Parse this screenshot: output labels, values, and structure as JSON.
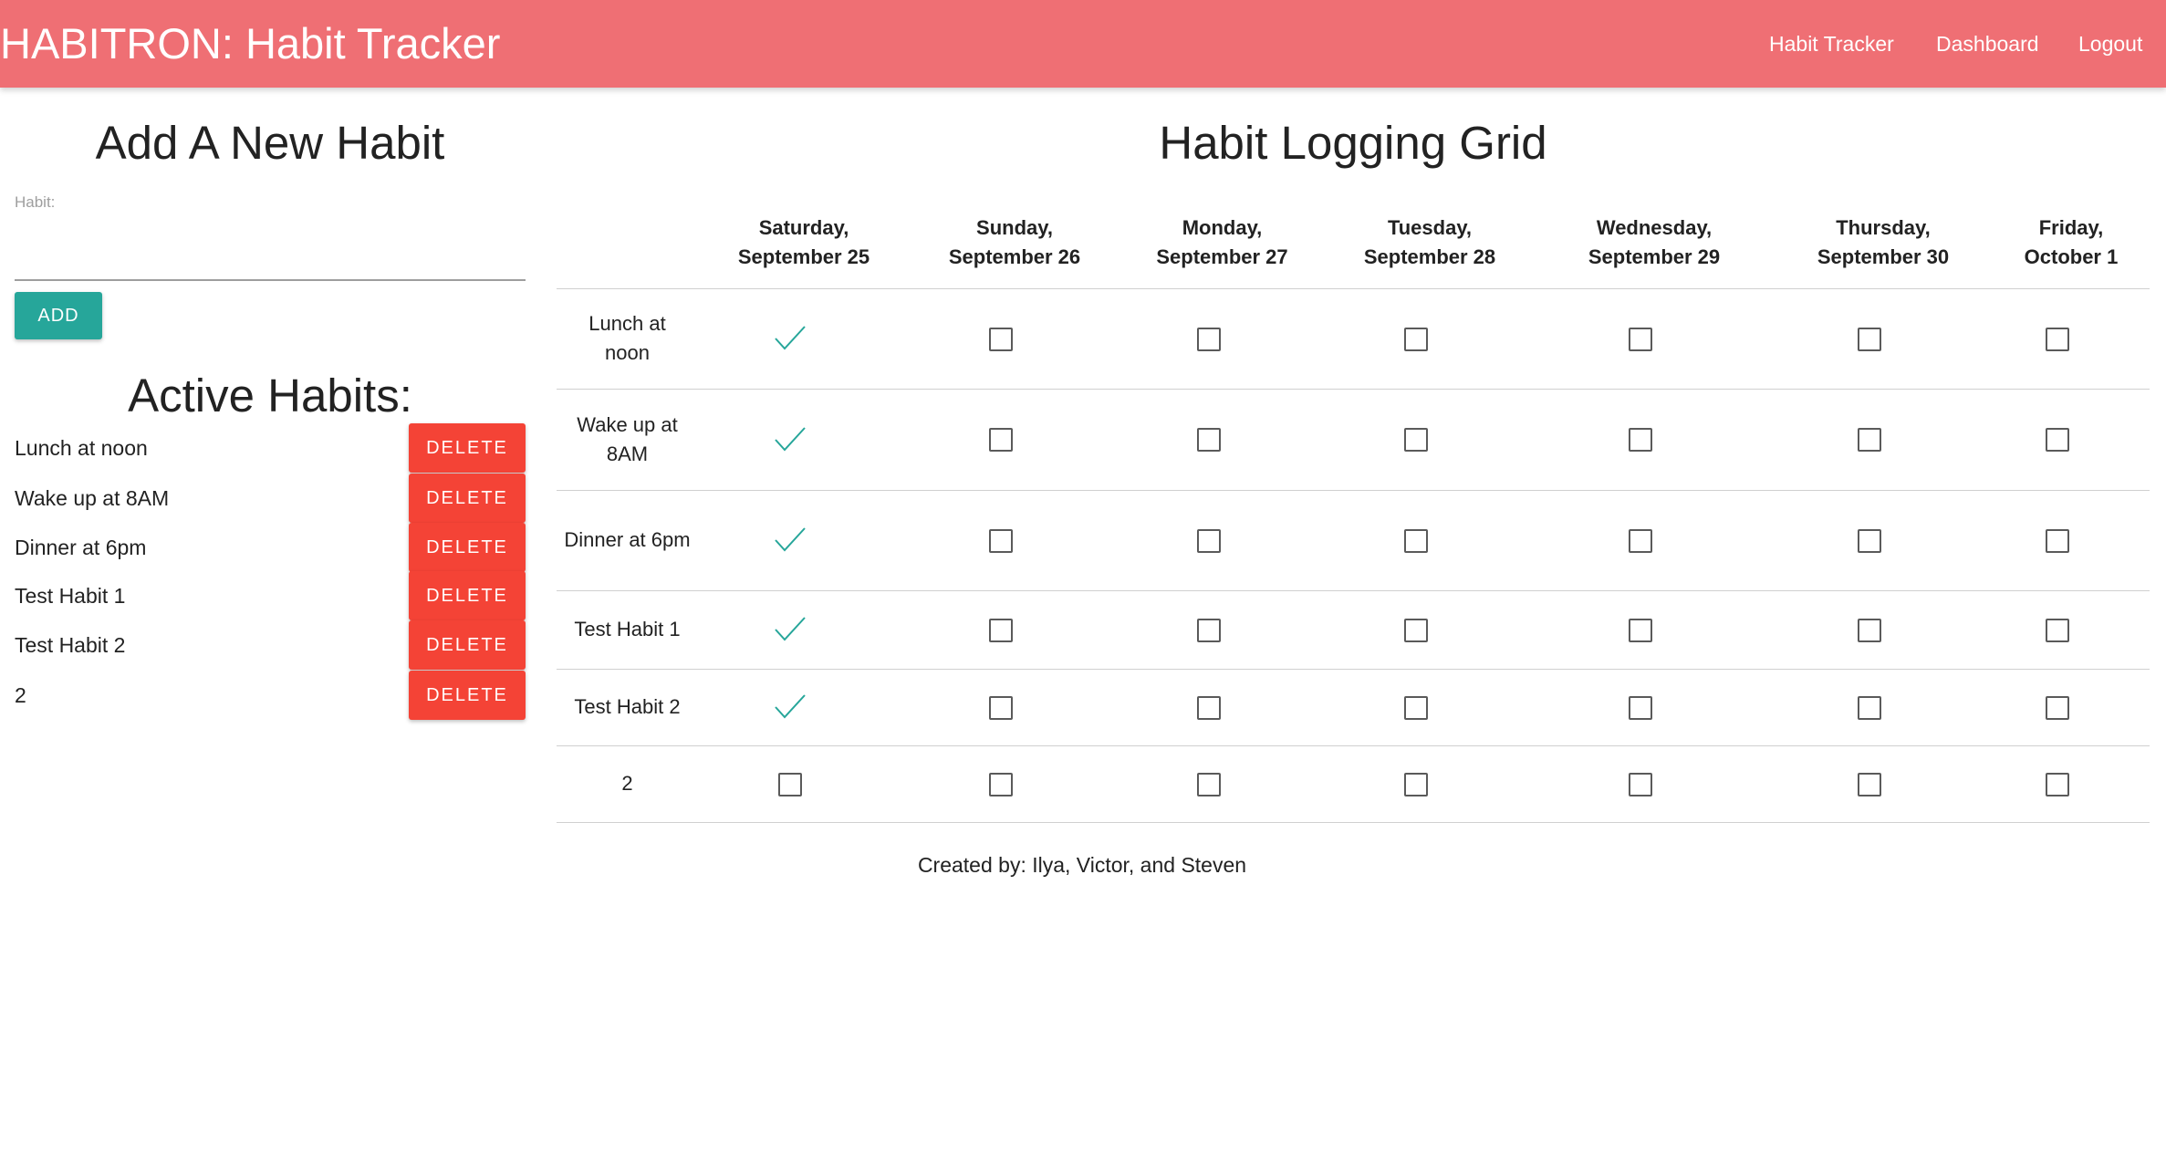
{
  "navbar": {
    "brand": "HABITRON: Habit Tracker",
    "links": [
      "Habit Tracker",
      "Dashboard",
      "Logout"
    ]
  },
  "add_habit": {
    "title": "Add A New Habit",
    "field_label": "Habit:",
    "input_value": "",
    "add_label": "ADD"
  },
  "active_habits": {
    "title": "Active Habits:",
    "delete_label": "DELETE",
    "items": [
      "Lunch at noon",
      "Wake up at 8AM",
      "Dinner at 6pm",
      "Test Habit 1",
      "Test Habit 2",
      "2"
    ]
  },
  "grid": {
    "title": "Habit Logging Grid",
    "days": [
      {
        "weekday": "Saturday,",
        "date": "September 25"
      },
      {
        "weekday": "Sunday,",
        "date": "September 26"
      },
      {
        "weekday": "Monday,",
        "date": "September 27"
      },
      {
        "weekday": "Tuesday,",
        "date": "September 28"
      },
      {
        "weekday": "Wednesday,",
        "date": "September 29"
      },
      {
        "weekday": "Thursday,",
        "date": "September 30"
      },
      {
        "weekday": "Friday,",
        "date": "October 1"
      }
    ],
    "rows": [
      {
        "habit": "Lunch at noon",
        "log": [
          true,
          false,
          false,
          false,
          false,
          false,
          false
        ]
      },
      {
        "habit": "Wake up at 8AM",
        "log": [
          true,
          false,
          false,
          false,
          false,
          false,
          false
        ]
      },
      {
        "habit": "Dinner at 6pm",
        "log": [
          true,
          false,
          false,
          false,
          false,
          false,
          false
        ]
      },
      {
        "habit": "Test Habit 1",
        "log": [
          true,
          false,
          false,
          false,
          false,
          false,
          false
        ]
      },
      {
        "habit": "Test Habit 2",
        "log": [
          true,
          false,
          false,
          false,
          false,
          false,
          false
        ]
      },
      {
        "habit": "2",
        "log": [
          false,
          false,
          false,
          false,
          false,
          false,
          false
        ]
      }
    ]
  },
  "footer": {
    "credits": "Created by: Ilya, Victor, and Steven"
  },
  "colors": {
    "navbar": "#ef6f74",
    "add_button": "#26a69a",
    "delete_button": "#f44336",
    "checkmark": "#26a69a"
  },
  "icons": {
    "checked": "checkmark-icon",
    "unchecked": "checkbox-empty-icon"
  }
}
